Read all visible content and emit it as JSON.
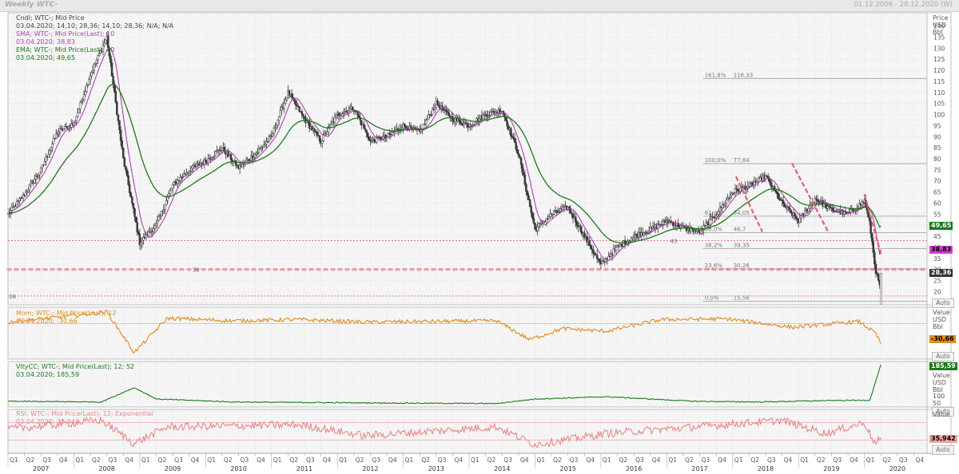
{
  "window": {
    "title": "Weekly WTC-",
    "range": "01.12.2006 - 28.12.2020 (W)"
  },
  "panels": {
    "price": {
      "legend": [
        {
          "line1": "Cndl; WTC-; Mid Price",
          "line2": "03.04.2020; 14,10; 28,36; 14,10; 28,36; N/A; N/A",
          "color": "#444444"
        },
        {
          "line1": "SMA; WTC-; Mid Price(Last); 10",
          "line2": "03.04.2020; 38,83",
          "color": "#b040b0"
        },
        {
          "line1": "EMA; WTC-; Mid Price(Last); 40",
          "line2": "03.04.2020; 49,65",
          "color": "#1a7a1a"
        }
      ],
      "axis_header": [
        "Price",
        "USD",
        "Bbl"
      ],
      "ticks": [
        "15",
        "20",
        "25",
        "30",
        "35",
        "40",
        "45",
        "50",
        "55",
        "60",
        "65",
        "70",
        "75",
        "80",
        "85",
        "90",
        "95",
        "100",
        "105",
        "110",
        "115",
        "120",
        "125",
        "130",
        "135",
        "140"
      ],
      "tags": [
        {
          "text": "49,65",
          "bg": "#1a7a1a",
          "fg": "#ffffff"
        },
        {
          "text": "38,83",
          "bg": "#cc44cc",
          "fg": "#000000"
        },
        {
          "text": "28,36",
          "bg": "#333333",
          "fg": "#ffffff"
        }
      ],
      "fib_levels": [
        {
          "label": "161,8%",
          "value": "116,33"
        },
        {
          "label": "100,0%",
          "value": "77,84"
        },
        {
          "label": "61,8%",
          "value": "54,05"
        },
        {
          "label": "50,0%",
          "value": "46,7"
        },
        {
          "label": "38,2%",
          "value": "39,35"
        },
        {
          "label": "23,6%",
          "value": "30,26"
        },
        {
          "label": "0,0%",
          "value": "15,56"
        }
      ],
      "annotations": {
        "left_30": "30",
        "left_18": "18",
        "mid_43": "43"
      },
      "auto_button": "Auto"
    },
    "momentum": {
      "legend": {
        "line1": "Mom; WTC-; Mid Price(Last); 12",
        "line2": "03.04.2020; -30,66",
        "color": "#e08a1e"
      },
      "axis_header": [
        "Value",
        "USD",
        "Bbl"
      ],
      "tag": {
        "text": "-30,66",
        "bg": "#e08a1e",
        "fg": "#000000"
      },
      "auto_button": "Auto"
    },
    "volatility": {
      "legend": {
        "line1": "VltyCC; WTC-; Mid Price(Last); 12; 52",
        "line2": "03.04.2020; 185,59",
        "color": "#1a7a1a"
      },
      "axis_header": [
        "Value",
        "USD",
        "Bbl"
      ],
      "ticks": [
        "50",
        "100"
      ],
      "tag": {
        "text": "185,59",
        "bg": "#1a7a1a",
        "fg": "#ffffff"
      },
      "auto_button": "Auto"
    },
    "rsi": {
      "legend": {
        "line1": "RSI; WTC-; Mid Price(Last); 12; Exponential",
        "line2": "03.04.2020; 35,942",
        "color": "#e8888a"
      },
      "axis_header": [
        "Value"
      ],
      "tag": {
        "text": "35,942",
        "bg": "#f0a0a0",
        "fg": "#000000"
      },
      "auto_button": "Auto"
    }
  },
  "time_axis": {
    "quarters": [
      "Q1",
      "Q2",
      "Q3",
      "Q4"
    ],
    "years": [
      "2007",
      "2008",
      "2009",
      "2010",
      "2011",
      "2012",
      "2013",
      "2014",
      "2015",
      "2016",
      "2017",
      "2018",
      "2019",
      "2020"
    ]
  },
  "colors": {
    "candle": "#3a3a3a",
    "sma": "#b040b0",
    "ema": "#1a7a1a",
    "momentum": "#e08a1e",
    "volatility": "#1a7a1a",
    "rsi": "#e8888a",
    "support": "#e06070",
    "trend": "#e06070",
    "grid": "#d4d4d4"
  },
  "chart_data": [
    {
      "type": "candlestick",
      "y_unit": "USD/Bbl",
      "ylim": [
        14,
        146
      ],
      "x_range": [
        "2007-01-01",
        "2020-12-28"
      ],
      "last_bar": {
        "date": "03.04.2020",
        "open": 14.1,
        "high": 28.36,
        "low": 14.1,
        "close": 28.36
      },
      "close_approx": {
        "x": [
          "2007-01",
          "2007-04",
          "2007-07",
          "2007-10",
          "2008-01",
          "2008-04",
          "2008-07",
          "2008-10",
          "2009-01",
          "2009-04",
          "2009-07",
          "2009-10",
          "2010-01",
          "2010-04",
          "2010-07",
          "2010-10",
          "2011-01",
          "2011-04",
          "2011-07",
          "2011-10",
          "2012-01",
          "2012-04",
          "2012-07",
          "2012-10",
          "2013-01",
          "2013-04",
          "2013-07",
          "2013-10",
          "2014-01",
          "2014-04",
          "2014-07",
          "2014-10",
          "2015-01",
          "2015-04",
          "2015-07",
          "2015-10",
          "2016-01",
          "2016-04",
          "2016-07",
          "2016-10",
          "2017-01",
          "2017-04",
          "2017-07",
          "2017-10",
          "2018-01",
          "2018-04",
          "2018-07",
          "2018-10",
          "2019-01",
          "2019-04",
          "2019-07",
          "2019-10",
          "2020-01",
          "2020-02",
          "2020-03",
          "2020-04"
        ],
        "y": [
          55,
          64,
          75,
          92,
          96,
          118,
          135,
          80,
          42,
          50,
          68,
          75,
          79,
          85,
          76,
          82,
          90,
          110,
          98,
          88,
          100,
          103,
          88,
          90,
          95,
          92,
          105,
          98,
          95,
          100,
          102,
          82,
          48,
          55,
          58,
          45,
          32,
          40,
          45,
          48,
          52,
          49,
          47,
          55,
          65,
          68,
          72,
          60,
          52,
          62,
          57,
          55,
          61,
          50,
          30,
          20
        ]
      },
      "annotations": [
        "30",
        "18",
        "43"
      ],
      "horizontal_levels": [
        30,
        43,
        18
      ],
      "fibonacci": {
        "161,8%": 116.33,
        "100,0%": 77.84,
        "61,8%": 54.05,
        "50,0%": 46.7,
        "38,2%": 39.35,
        "23,6%": 30.26,
        "0,0%": 15.56
      },
      "overlays": [
        {
          "name": "SMA; WTC-; Mid Price(Last); 10",
          "last": 38.83
        },
        {
          "name": "EMA; WTC-; Mid Price(Last); 40",
          "last": 49.65
        }
      ]
    },
    {
      "type": "line",
      "name": "Mom; WTC-; Mid Price(Last); 12",
      "last": -30.66,
      "x": [
        "2007-01",
        "2008-01",
        "2008-07",
        "2008-12",
        "2009-06",
        "2010-06",
        "2011-06",
        "2012-06",
        "2013-06",
        "2014-06",
        "2014-12",
        "2015-06",
        "2016-02",
        "2016-12",
        "2017-12",
        "2018-12",
        "2019-12",
        "2020-03",
        "2020-04"
      ],
      "y": [
        2,
        12,
        18,
        -45,
        8,
        4,
        6,
        2,
        3,
        4,
        -25,
        -8,
        -12,
        6,
        7,
        -6,
        3,
        -15,
        -31
      ]
    },
    {
      "type": "line",
      "name": "VltyCC; WTC-; Mid Price(Last); 12; 52",
      "last": 185.59,
      "x": [
        "2007-01",
        "2008-06",
        "2008-12",
        "2009-04",
        "2010-06",
        "2012-06",
        "2014-06",
        "2015-01",
        "2016-02",
        "2017-06",
        "2018-06",
        "2019-06",
        "2020-02",
        "2020-03",
        "2020-04"
      ],
      "y": [
        25,
        22,
        85,
        35,
        22,
        18,
        15,
        35,
        45,
        25,
        22,
        28,
        30,
        110,
        185.59
      ]
    },
    {
      "type": "line",
      "name": "RSI; WTC-; Mid Price(Last); 12; Exponential",
      "last": 35.942,
      "x": [
        "2007-01",
        "2008-06",
        "2008-12",
        "2009-06",
        "2011-06",
        "2012-06",
        "2014-06",
        "2015-01",
        "2016-02",
        "2017-06",
        "2018-10",
        "2019-06",
        "2020-01",
        "2020-03",
        "2020-04"
      ],
      "y": [
        55,
        75,
        22,
        60,
        65,
        40,
        60,
        20,
        45,
        60,
        75,
        45,
        70,
        20,
        35.9
      ]
    }
  ]
}
